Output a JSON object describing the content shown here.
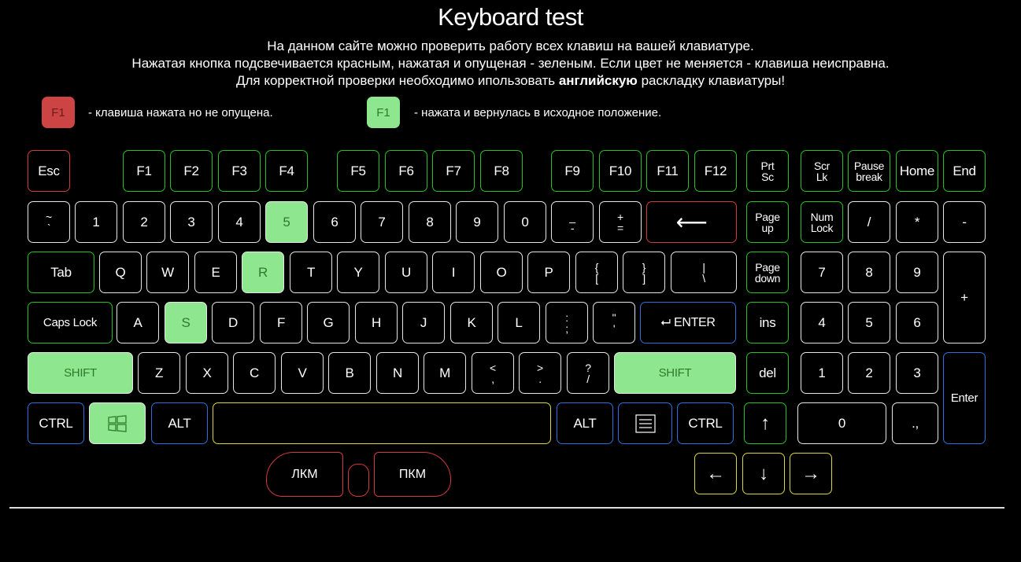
{
  "title": "Keyboard test",
  "description": {
    "line1": "На данном сайте можно проверить работу всех клавиш на вашей клавиатуре.",
    "line2": "Нажатая кнопка подсвечивается красным, нажатая и опущеная - зеленым. Если цвет не меняется - клавиша неисправна.",
    "line3_before": "Для корректной проверки необходимо ипользовать ",
    "line3_bold": "английскую",
    "line3_after": " раскладку клавиатуры!"
  },
  "legend": {
    "pressed_key": "F1",
    "pressed_text": "- клавиша нажата но не опущена.",
    "released_key": "F1",
    "released_text": "- нажата и вернулась в исходное положение."
  },
  "colors": {
    "pressed_bg": "#cc4444",
    "released_bg": "#8ee68e",
    "border_default": "#e6e6e6",
    "border_green": "#22c322",
    "border_red": "#d43a3a",
    "border_blue": "#2d6fe0",
    "border_yellow": "#d8d83a"
  },
  "keys": {
    "esc": "Esc",
    "f1": "F1",
    "f2": "F2",
    "f3": "F3",
    "f4": "F4",
    "f5": "F5",
    "f6": "F6",
    "f7": "F7",
    "f8": "F8",
    "f9": "F9",
    "f10": "F10",
    "f11": "F11",
    "f12": "F12",
    "prtsc_1": "Prt",
    "prtsc_2": "Sc",
    "scrlk_1": "Scr",
    "scrlk_2": "Lk",
    "pause_1": "Pause",
    "pause_2": "break",
    "home": "Home",
    "end": "End",
    "tilde_1": "~",
    "tilde_2": "`",
    "d1": "1",
    "d2": "2",
    "d3": "3",
    "d4": "4",
    "d5": "5",
    "d6": "6",
    "d7": "7",
    "d8": "8",
    "d9": "9",
    "d0": "0",
    "minus_1": "_",
    "minus_2": "-",
    "plus_1": "+",
    "plus_2": "=",
    "backspace": "⟵",
    "pgup_1": "Page",
    "pgup_2": "up",
    "numlock_1": "Num",
    "numlock_2": "Lock",
    "np_slash": "/",
    "np_star": "*",
    "np_minus": "-",
    "tab": "Tab",
    "q": "Q",
    "w": "W",
    "e": "E",
    "r": "R",
    "t": "T",
    "y": "Y",
    "u": "U",
    "i": "I",
    "o": "O",
    "p": "P",
    "lbr_1": "{",
    "lbr_2": "[",
    "rbr_1": "}",
    "rbr_2": "]",
    "bsl_1": "|",
    "bsl_2": "\\",
    "pgdn_1": "Page",
    "pgdn_2": "down",
    "np7": "7",
    "np8": "8",
    "np9": "9",
    "np_plus": "+",
    "caps": "Caps Lock",
    "a": "A",
    "s": "S",
    "d": "D",
    "f": "F",
    "g": "G",
    "h": "H",
    "j": "J",
    "k": "K",
    "l": "L",
    "semi_1": ":",
    "semi_2": ";",
    "quote_1": "\"",
    "quote_2": "'",
    "enter": "⮠ ENTER",
    "ins": "ins",
    "np4": "4",
    "np5": "5",
    "np6": "6",
    "lshift": "SHIFT",
    "z": "Z",
    "x": "X",
    "c": "C",
    "v": "V",
    "b": "B",
    "n": "N",
    "m": "M",
    "comma_1": "<",
    "comma_2": ",",
    "period_1": ">",
    "period_2": ".",
    "slash_1": "?",
    "slash_2": "/",
    "rshift": "SHIFT",
    "del": "del",
    "np1": "1",
    "np2": "2",
    "np3": "3",
    "np_enter": "Enter",
    "lctrl": "CTRL",
    "lalt": "ALT",
    "space": "",
    "ralt": "ALT",
    "rctrl": "CTRL",
    "up": "↑",
    "np0": "0",
    "np_dot": ".,",
    "left": "←",
    "down": "↓",
    "right": "→"
  },
  "mouse": {
    "lkm": "ЛКМ",
    "pkm": "ПКМ"
  },
  "icons": {
    "windows": "windows-icon",
    "menu": "context-menu-icon"
  }
}
